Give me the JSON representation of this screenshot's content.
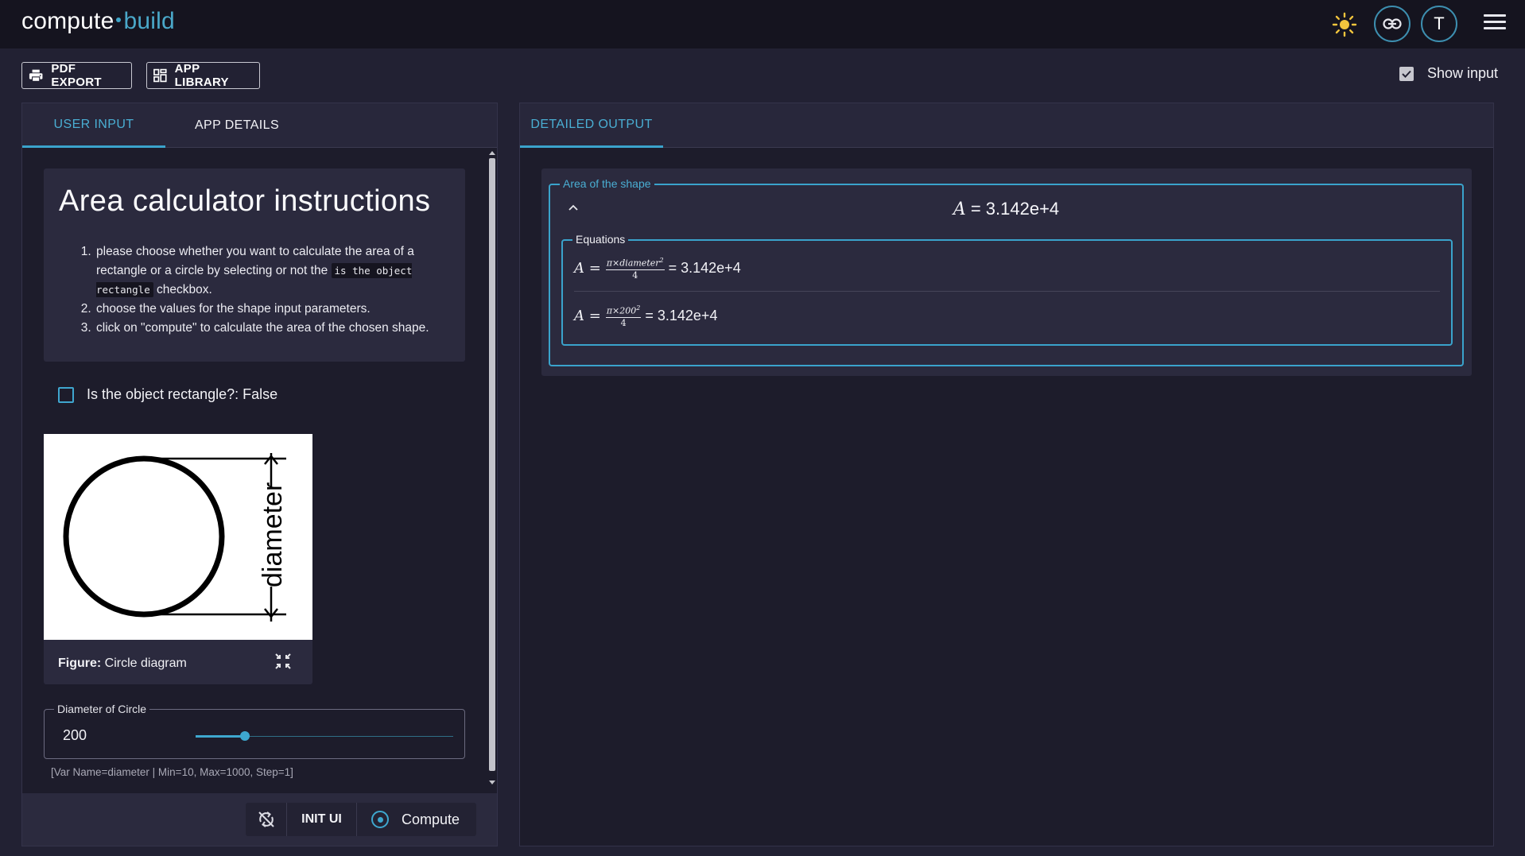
{
  "header": {
    "brand_left": "compute",
    "brand_right": "build",
    "avatar_letter": "T",
    "icons": [
      "sun-icon",
      "link-icon",
      "menu-icon"
    ]
  },
  "toolbar": {
    "pdf_export": "PDF EXPORT",
    "app_library": "APP LIBRARY",
    "show_input": "Show input",
    "show_input_checked": true
  },
  "left": {
    "tabs": [
      {
        "label": "USER INPUT",
        "active": true
      },
      {
        "label": "APP DETAILS",
        "active": false
      }
    ],
    "instructions": {
      "title": "Area calculator instructions",
      "step1_a": "please choose whether you want to calculate the area of a rectangle or a circle by selecting or not the ",
      "step1_code": "is the object rectangle",
      "step1_b": " checkbox.",
      "step2": "choose the values for the shape input parameters.",
      "step3": "click on \"compute\" to calculate the area of the chosen shape."
    },
    "checkbox_label": "Is the object rectangle?: False",
    "checkbox_checked": false,
    "figure": {
      "diagram_label": "diameter",
      "caption_bold": "Figure:",
      "caption_text": " Circle diagram"
    },
    "diameter": {
      "legend": "Diameter of Circle",
      "value": "200",
      "min": 10,
      "max": 1000,
      "hint": "[Var Name=diameter | Min=10, Max=1000, Step=1]"
    },
    "buttons": {
      "init_ui": "INIT UI",
      "compute": "Compute"
    }
  },
  "right": {
    "tab": "DETAILED OUTPUT",
    "output": {
      "legend": "Area of the shape",
      "result_var": "A",
      "result_value": "= 3.142e+4",
      "equations_legend": "Equations",
      "eq1_num": "π×diameter",
      "eq1_sup": "2",
      "eq1_den": "4",
      "eq1_value": "= 3.142e+4",
      "eq2_num": "π×200",
      "eq2_sup": "2",
      "eq2_den": "4",
      "eq2_value": "= 3.142e+4",
      "eq_lhs": "A ="
    }
  },
  "colors": {
    "accent": "#3aa3cc",
    "background": "#222133",
    "header": "#15141f",
    "card": "#2b2a3e"
  }
}
